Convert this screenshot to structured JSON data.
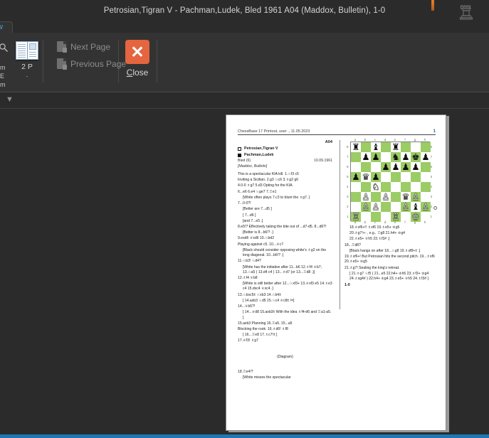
{
  "window": {
    "title": "Petrosian,Tigran V - Pachman,Ludek, Bled 1961  A04  (Maddox, Bulletin), 1-0",
    "logo_icon": "chess-rook-icon"
  },
  "ribbon": {
    "active_tab": "w",
    "group_title": "Print Preview",
    "two_page_button": {
      "label": "2 P",
      "sub": "·",
      "icon": "two-page-view-icon"
    },
    "next_page": {
      "label": "Next Page",
      "icon": "next-page-icon",
      "enabled": false
    },
    "previous_page": {
      "label": "Previous Page",
      "icon": "previous-page-icon",
      "enabled": false
    },
    "close": {
      "label": "Close",
      "accel": "C",
      "icon": "close-x-icon"
    },
    "left_group_labels": [
      "m",
      "E",
      "m"
    ],
    "collapse_glyph": "▼"
  },
  "document": {
    "header_left": "ChessBase 17 Printout, user ., 11.05.2023",
    "page_number": "1",
    "eco": "A04",
    "white_player": "Petrosian,Tigran V",
    "black_player": "Pachman,Ludek",
    "event": "Bled (6)",
    "date": "10.09.1961",
    "source": "[Maddox, Bulletin]",
    "diagram_caption": "(Diagram)",
    "result": "1-0",
    "left_column": [
      {
        "type": "para",
        "text": "This is a spectacular KIA kill. 1.♘f3 c5"
      },
      {
        "type": "para",
        "text": "Inviting a Sicilian. 2.g3 ♘c6 3.♗g2 g6"
      },
      {
        "type": "para",
        "text": "4.0-0 ♗g7 5.d3 Opting for the KIA."
      },
      {
        "type": "para",
        "text": "6...e6 6.e4 ♘ge7 7.♖e1"
      },
      {
        "type": "var",
        "text": "[White often plays 7.c3 to blunt the ♗g7. ]"
      },
      {
        "type": "para",
        "text": "7...0-0?!"
      },
      {
        "type": "var",
        "text": "[Better are 7...d5 ]"
      },
      {
        "type": "var",
        "text": "[ 7...d6 ]"
      },
      {
        "type": "var",
        "text": "[and 7...e5 .]"
      },
      {
        "type": "para",
        "text": "8.e5!? Effectively taking the bite out of ...d7-d5.  8...d6?!"
      },
      {
        "type": "var",
        "text": "[Better is  8...b6!? .]"
      },
      {
        "type": "para",
        "text": "9.exd6 ♕xd6 10.♘bd2"
      },
      {
        "type": "para",
        "text": "Playing against c5. 10...♕c7"
      },
      {
        "type": "var",
        "text": "[Black should consider opposing white's ♗g2 on the long diagonal. 10...b6!? .]"
      },
      {
        "type": "para",
        "text": "11.♘b3! ♘d4?"
      },
      {
        "type": "var",
        "text": "[White has the initiative after 11...b6 12.♗f4 ♕b7; 13.♘a5 ( 13.d4 c4 ) 13...♗d7  (or 13...♖d8 .)]"
      },
      {
        "type": "para",
        "text": "12.♗f4 ♕b8"
      },
      {
        "type": "var",
        "text": "[White is still better after 12...♘xf3+ 13.♕xf3 e5 14.♗e3 c4 15.dxc4 ♕xc4 .]"
      },
      {
        "type": "para",
        "text": "13.♘bxc5± ♘xb3 14.♘b4±"
      },
      {
        "type": "var",
        "text": "[ 14.axb3 ♘d5 15.♘c4 ♕c8± /=]"
      },
      {
        "type": "para",
        "text": "14...♕b5?!"
      },
      {
        "type": "var",
        "text": "[ 14...♕d8  15.axb3± With the idea ♗f4-d6 and ♖a1-a5. ]"
      },
      {
        "type": "para",
        "text": "15.axb3 Planning 16.♖a5. 15...a5"
      },
      {
        "type": "para",
        "text": "Blocking the rook. 16.♗d6! ♗f8"
      },
      {
        "type": "var",
        "text": "[ 16...♖e8  17.♗c7!± ]"
      },
      {
        "type": "para",
        "text": "17.♕f3! ♗g7"
      },
      {
        "type": "para",
        "text": "18.♖e4!? "
      },
      {
        "type": "var",
        "text": "[White misses the spectacular"
      }
    ],
    "right_column": [
      {
        "type": "var",
        "text": "18.♕xf6+!! ♗xf6  19.♗e5+ ♔g5"
      },
      {
        "type": "var",
        "text": "20.♗g7!+- , e.g., ♖g8  21.h4+  ♔g4"
      },
      {
        "type": "var",
        "text": "22.♗e5+  ♕h5  23.♗f3# .]"
      },
      {
        "type": "para",
        "text": "18...♖d8?"
      },
      {
        "type": "var",
        "text": "[Black hangs on after 18...♘g8 19.♗xf8+± .]"
      },
      {
        "type": "para",
        "text": "19.♗xf6+! But Petrosian hits the second pitch.  19...♗xf6  20.♗e5+  ♔g5"
      },
      {
        "type": "para",
        "text": "21.♗g7! Sealing the king's retreat."
      },
      {
        "type": "var",
        "text": "[ 21.♗g7  ♘f5  ( 21...e5  22.h4+  ♔h5 23.♗f3+  ♔g4  24.♗xg4# ) 22.h4+ ♔g4  23.♗e5+  ♕h5  24.♗f3# ]"
      },
      {
        "type": "result",
        "text": "1-0"
      }
    ],
    "board": {
      "files": [
        "a",
        "b",
        "c",
        "d",
        "e",
        "f",
        "g",
        "h"
      ],
      "ranks": [
        "8",
        "7",
        "6",
        "5",
        "4",
        "3",
        "2",
        "1"
      ],
      "rows": [
        [
          "br",
          "",
          "bb",
          "",
          "br",
          "",
          "",
          ""
        ],
        [
          "",
          "bp",
          "bp",
          "",
          "bn",
          "bp",
          "bk",
          "bp"
        ],
        [
          "",
          "",
          "",
          "bp",
          "bp",
          "bp",
          "bp",
          ""
        ],
        [
          "bp",
          "bq",
          "bp",
          "",
          "",
          "",
          "",
          ""
        ],
        [
          "",
          "",
          "wn",
          "",
          "",
          "",
          "",
          ""
        ],
        [
          "",
          "wp",
          "",
          "wp",
          "",
          "bq",
          "wp",
          ""
        ],
        [
          "",
          "wp",
          "wp",
          "",
          "",
          "wp",
          "bb",
          "wp"
        ],
        [
          "wr",
          "",
          "",
          "",
          "wr",
          "",
          "wk",
          ""
        ]
      ],
      "glyphs": {
        "wk": "♔",
        "wq": "♕",
        "wr": "♖",
        "wb": "♗",
        "wn": "♘",
        "wp": "♙",
        "bk": "♚",
        "bq": "♛",
        "br": "♜",
        "bb": "♝",
        "bn": "♞",
        "bp": "♟"
      }
    }
  },
  "colors": {
    "chrome": "#2b2b2b",
    "ribbon": "#333333",
    "accent_close": "#e4653f",
    "tab_text": "#4aa3e0",
    "board_dark": "#9ccc65",
    "board_light": "#ffffff",
    "status_strip": "#1f78b4"
  }
}
